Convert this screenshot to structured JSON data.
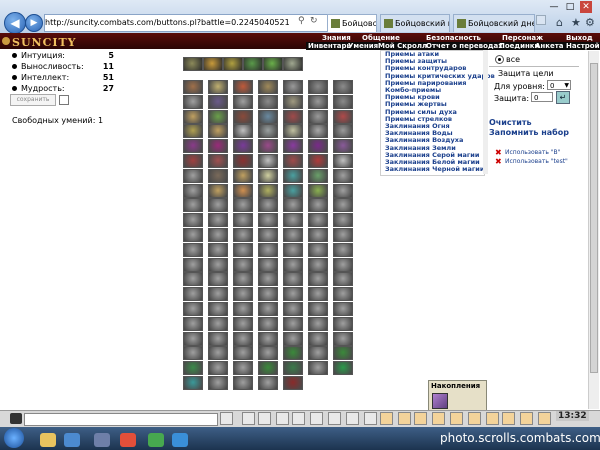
{
  "browser": {
    "url": "http://suncity.combats.com/buttons.pl?battle=0.2245040521",
    "tabs": [
      "Бойцовский к...",
      "Бойцовский клуб...",
      "Бойцовский днев..."
    ]
  },
  "site": {
    "logo": "SUNCITY",
    "top_nav": [
      "Знания",
      "Общение",
      "Безопасность",
      "Персонаж",
      "Выход"
    ],
    "sub_nav": [
      "Инвентарь",
      "Умения",
      "Мой Скролл",
      "Отчет о переводах",
      "Поединки",
      "Анкета",
      "Настрой"
    ]
  },
  "stats": [
    {
      "label": "Интуиция:",
      "value": "5"
    },
    {
      "label": "Выносливость:",
      "value": "11"
    },
    {
      "label": "Интеллект:",
      "value": "51"
    },
    {
      "label": "Мудрость:",
      "value": "27"
    }
  ],
  "save_button": "сохранить",
  "free_skills": "Свободных умений: 1",
  "categories": [
    "Приемы атаки",
    "Приемы защиты",
    "Приемы контрударов",
    "Приемы критических ударов",
    "Приемы парирования",
    "Комбо-приемы",
    "Приемы крови",
    "Приемы жертвы",
    "Приемы силы духа",
    "Приемы стрелков",
    "Заклинания Огня",
    "Заклинания Воды",
    "Заклинания Воздуха",
    "Заклинания Земли",
    "Заклинания Серой магии",
    "Заклинания Белой магии",
    "Заклинания Черной магии"
  ],
  "right_panel": {
    "all_label": "все",
    "target_protection": "Защита цели",
    "level_label": "Для уровня:",
    "level_value": "0",
    "protection_label": "Защита:",
    "protection_value": "0",
    "clear_link": "Очистить",
    "remember_link": "Запомнить набор",
    "use_items": [
      "Использовать \"B\"",
      "Использовать \"test\""
    ]
  },
  "accumulation_label": "Накопления",
  "clock": "13:32",
  "watermark": "photo.scrolls.combats.com",
  "colors": {
    "header_red": "#4a0a08",
    "link_blue": "#1a3f8c",
    "taskbar": "#2a4a70"
  },
  "icons": {
    "back": "back-arrow-icon",
    "forward": "forward-arrow-icon",
    "home": "home-icon",
    "star": "star-icon",
    "gear": "gear-icon",
    "close": "close-icon"
  }
}
